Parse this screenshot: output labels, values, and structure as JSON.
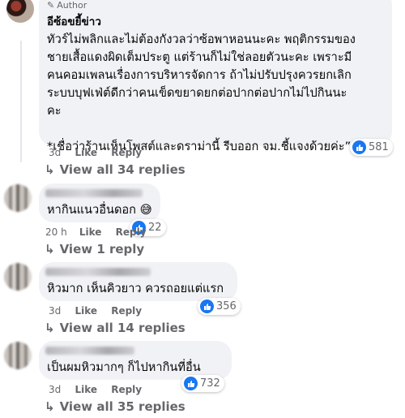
{
  "comments": [
    {
      "badge": "Author",
      "name": "อีซ้อขยี้ข่าว",
      "text": "ทัวร์ไม่พลิกและไม่ต้องกังวลว่าซ้อพาหอนนะคะ พฤติกรรมของ\nชายเสื้อแดงผิดเต็มประตู แต่ร้านก็ไม่ใช่ลอยตัวนะคะ เพราะมี\nคนคอมเพลนเรื่องการบริหารจัดการ ถ้าไม่ปรับปรุงควรยกเลิก\nระบบบุฟเฟ่ต์ดีกว่าคนเข็ดขยาดยกต่อปากต่อปากไม่ไปกินนะ\nคะ\n\n*เชื่อว่าร้านเห็นโพสต์และดราม่านี้ รีบออก จม.ชี้แจงด้วยค่ะ”",
      "time": "3d",
      "like": "Like",
      "reply": "Reply",
      "reactions": "581",
      "view_replies": "View all 34 replies"
    },
    {
      "text": "หากินแนวอื่นดอก 😅",
      "time": "20 h",
      "like": "Like",
      "reply": "Reply",
      "reactions": "22",
      "view_replies": "View 1 reply"
    },
    {
      "text": "หิวมาก เห็นคิวยาว ควรถอยแต่แรก",
      "time": "3d",
      "like": "Like",
      "reply": "Reply",
      "reactions": "356",
      "view_replies": "View all 14 replies"
    },
    {
      "text": "เป็นผมหิวมากๆ ก็ไปหากินที่อื่น",
      "time": "3d",
      "like": "Like",
      "reply": "Reply",
      "reactions": "732",
      "view_replies": "View all 35 replies"
    }
  ],
  "icons": {
    "author_badge": "pencil-icon",
    "reaction_like": "like-icon",
    "reaction_haha": "haha-icon",
    "reply_arrow": "reply-arrow-icon"
  },
  "colors": {
    "bubble": "#f0f2f5",
    "like_blue": "#1877f2",
    "meta_gray": "#65676b"
  }
}
